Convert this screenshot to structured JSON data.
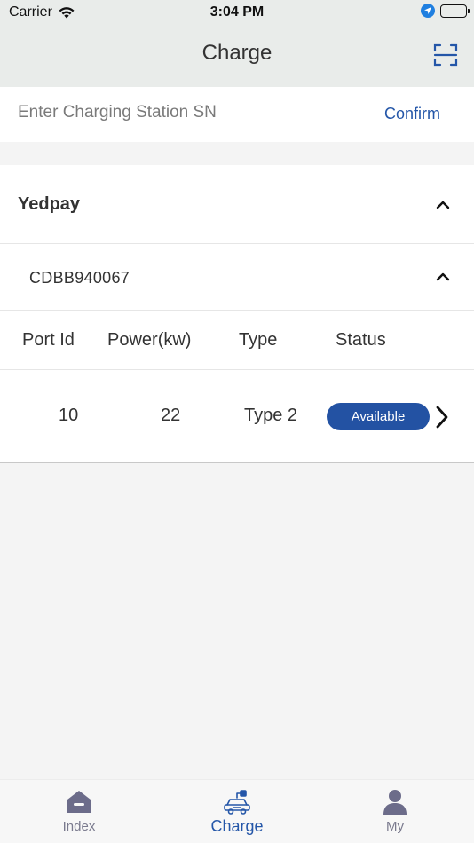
{
  "status_bar": {
    "carrier": "Carrier",
    "time": "3:04 PM"
  },
  "nav": {
    "title": "Charge",
    "scan_icon": "scan-icon"
  },
  "search": {
    "placeholder": "Enter Charging Station SN",
    "value": "",
    "confirm_label": "Confirm"
  },
  "group": {
    "title": "Yedpay",
    "expanded": true
  },
  "station": {
    "sn": "CDBB940067",
    "expanded": true
  },
  "table": {
    "headers": {
      "port_id": "Port Id",
      "power": "Power(kw)",
      "type": "Type",
      "status": "Status"
    },
    "rows": [
      {
        "port_id": "10",
        "power": "22",
        "type": "Type 2",
        "status": "Available"
      }
    ]
  },
  "tabs": [
    {
      "label": "Index",
      "icon": "home-icon",
      "active": false
    },
    {
      "label": "Charge",
      "icon": "car-charging-icon",
      "active": true
    },
    {
      "label": "My",
      "icon": "user-icon",
      "active": false
    }
  ],
  "colors": {
    "accent": "#2456a8",
    "badge_bg": "#2352a3",
    "header_bg": "#e9ecea",
    "tab_inactive": "#6c6c8a",
    "tab_active": "#2456a8"
  }
}
